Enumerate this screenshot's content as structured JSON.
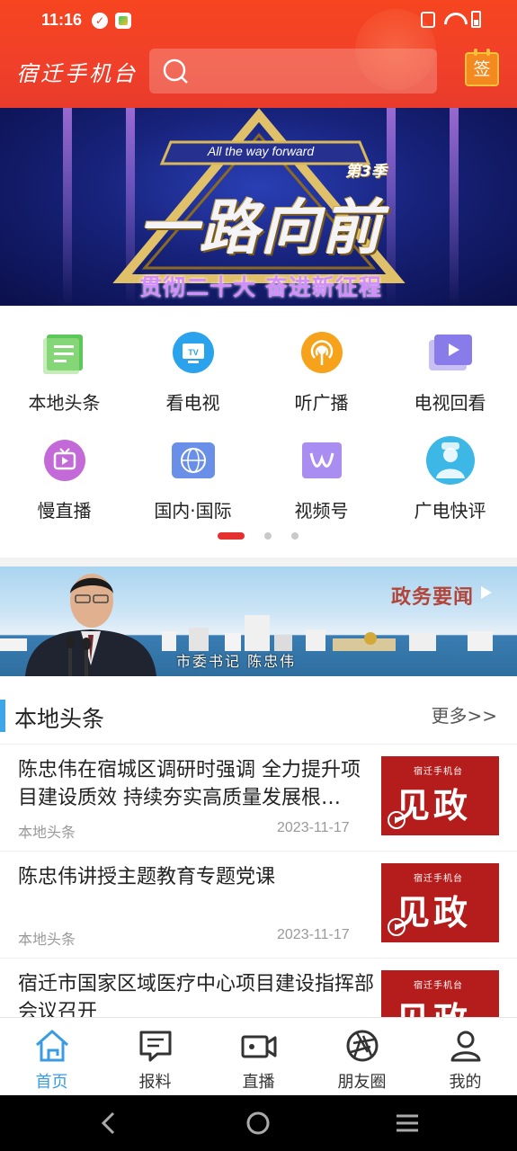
{
  "status_bar": {
    "time": "11:16"
  },
  "header": {
    "logo": "宿迁手机台",
    "search_placeholder": "",
    "sign_label": "签"
  },
  "banner": {
    "english": "All the way forward",
    "season": "第3季",
    "main_title": "一路向前",
    "subtitle": "贯彻二十大 奋进新征程"
  },
  "grid": {
    "items": [
      {
        "label": "本地头条",
        "icon": "news-list-icon",
        "color": "#5cc85a"
      },
      {
        "label": "看电视",
        "icon": "tv-icon",
        "color": "#2ba3ec"
      },
      {
        "label": "听广播",
        "icon": "radio-icon",
        "color": "#f7a21b"
      },
      {
        "label": "电视回看",
        "icon": "video-playback-icon",
        "color": "#8a7bea"
      },
      {
        "label": "慢直播",
        "icon": "slow-live-icon",
        "color": "#c46ad8"
      },
      {
        "label": "国内·国际",
        "icon": "globe-icon",
        "color": "#6a8fe8"
      },
      {
        "label": "视频号",
        "icon": "video-channel-icon",
        "color": "#a98df0"
      },
      {
        "label": "广电快评",
        "icon": "comment-icon",
        "color": "#3cb7e6"
      }
    ],
    "page_count": 3,
    "active_page": 1
  },
  "promo": {
    "title": "政务要闻",
    "caption": "市委书记 陈忠伟"
  },
  "section": {
    "title": "本地头条",
    "more": "更多>>"
  },
  "news": [
    {
      "title": "陈忠伟在宿城区调研时强调 全力提升项目建设质效 持续夯实高质量发展根…",
      "source": "本地头条",
      "date": "2023-11-17",
      "thumb_text": "见政",
      "thumb_logo": "宿迁手机台"
    },
    {
      "title": "陈忠伟讲授主题教育专题党课",
      "source": "本地头条",
      "date": "2023-11-17",
      "thumb_text": "见政",
      "thumb_logo": "宿迁手机台"
    },
    {
      "title": "宿迁市国家区域医疗中心项目建设指挥部会议召开",
      "source": "",
      "date": "",
      "thumb_text": "见政",
      "thumb_logo": "宿迁手机台"
    }
  ],
  "tabbar": {
    "tabs": [
      {
        "label": "首页",
        "icon": "home-icon",
        "active": true
      },
      {
        "label": "报料",
        "icon": "report-icon",
        "active": false
      },
      {
        "label": "直播",
        "icon": "live-camera-icon",
        "active": false
      },
      {
        "label": "朋友圈",
        "icon": "aperture-icon",
        "active": false
      },
      {
        "label": "我的",
        "icon": "profile-icon",
        "active": false
      }
    ]
  },
  "colors": {
    "header_red": "#f0402a",
    "accent_blue": "#3b9be0",
    "thumb_red": "#b51d1d"
  }
}
